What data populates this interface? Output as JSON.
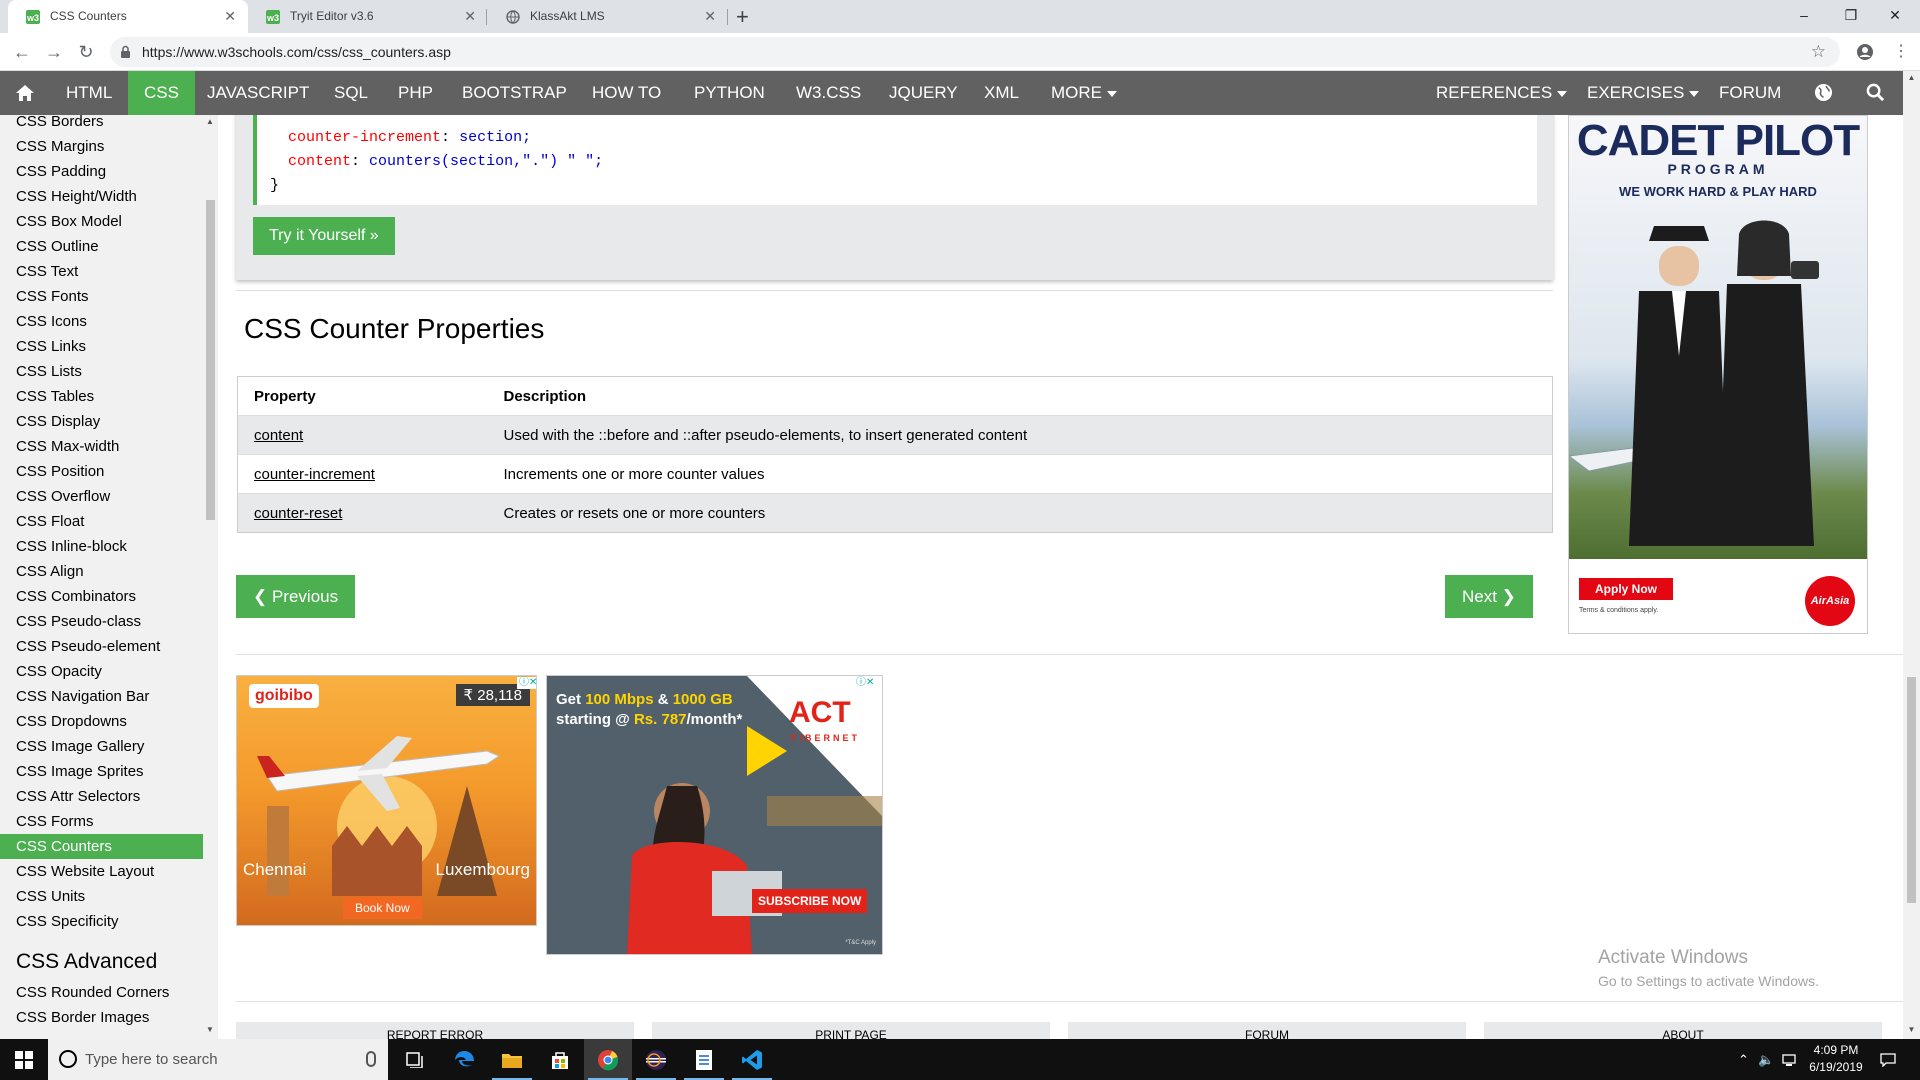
{
  "browser": {
    "tabs": [
      {
        "title": "CSS Counters",
        "active": true
      },
      {
        "title": "Tryit Editor v3.6",
        "active": false
      },
      {
        "title": "KlassAkt LMS",
        "active": false
      }
    ],
    "url": "https://www.w3schools.com/css/css_counters.asp",
    "window_controls": [
      "–",
      "❐",
      "✕"
    ],
    "nav_icons": [
      "back-icon",
      "forward-icon",
      "reload-icon"
    ]
  },
  "topnav": {
    "home_icon": "home-icon",
    "items": [
      "HTML",
      "CSS",
      "JAVASCRIPT",
      "SQL",
      "PHP",
      "BOOTSTRAP",
      "HOW TO",
      "PYTHON",
      "W3.CSS",
      "JQUERY",
      "XML",
      "MORE"
    ],
    "active": "CSS",
    "right_items": [
      "REFERENCES",
      "EXERCISES",
      "FORUM"
    ],
    "right_icons": [
      "globe-icon",
      "search-icon"
    ]
  },
  "sidebar": {
    "items": [
      "CSS Borders",
      "CSS Margins",
      "CSS Padding",
      "CSS Height/Width",
      "CSS Box Model",
      "CSS Outline",
      "CSS Text",
      "CSS Fonts",
      "CSS Icons",
      "CSS Links",
      "CSS Lists",
      "CSS Tables",
      "CSS Display",
      "CSS Max-width",
      "CSS Position",
      "CSS Overflow",
      "CSS Float",
      "CSS Inline-block",
      "CSS Align",
      "CSS Combinators",
      "CSS Pseudo-class",
      "CSS Pseudo-element",
      "CSS Opacity",
      "CSS Navigation Bar",
      "CSS Dropdowns",
      "CSS Image Gallery",
      "CSS Image Sprites",
      "CSS Attr Selectors",
      "CSS Forms",
      "CSS Counters",
      "CSS Website Layout",
      "CSS Units",
      "CSS Specificity"
    ],
    "active": "CSS Counters",
    "advanced_heading": "CSS Advanced",
    "advanced_items": [
      "CSS Rounded Corners",
      "CSS Border Images"
    ]
  },
  "example": {
    "code_lines": [
      {
        "prop": "counter-increment",
        "value": "section;"
      },
      {
        "prop": "content",
        "value": "counters(section,\".\") \" \";"
      }
    ],
    "closing_brace": "}",
    "try_button": "Try it Yourself »"
  },
  "section": {
    "title": "CSS Counter Properties",
    "table_headers": [
      "Property",
      "Description"
    ],
    "rows": [
      {
        "property": "content",
        "description": "Used with the ::before and ::after pseudo-elements, to insert generated content"
      },
      {
        "property": "counter-increment",
        "description": "Increments one or more counter values"
      },
      {
        "property": "counter-reset",
        "description": "Creates or resets one or more counters"
      }
    ]
  },
  "pager": {
    "previous": "❮ Previous",
    "next": "Next ❯"
  },
  "ads": {
    "right": {
      "title": "CADET PILOT",
      "subtitle": "PROGRAM",
      "tagline": "WE WORK HARD & PLAY HARD",
      "apply": "Apply Now",
      "terms": "Terms & conditions apply.",
      "brand": "AirAsia"
    },
    "goibibo": {
      "logo": "goibibo",
      "price": "₹ 28,118",
      "from": "Chennai",
      "to": "Luxembourg",
      "cta": "Book Now"
    },
    "act": {
      "line1_a": "Get ",
      "line1_b": "100 Mbps",
      "line1_c": " & ",
      "line1_d": "1000 GB",
      "line2_a": "starting @ ",
      "line2_b": "Rs. 787",
      "line2_c": "/month*",
      "logo": "ACT",
      "logo_sub": "FIBERNET",
      "cta": "SUBSCRIBE NOW",
      "tc": "*T&C Apply"
    }
  },
  "footer": [
    "REPORT ERROR",
    "PRINT PAGE",
    "FORUM",
    "ABOUT"
  ],
  "watermark": {
    "line1": "Activate Windows",
    "line2": "Go to Settings to activate Windows."
  },
  "taskbar": {
    "search_placeholder": "Type here to search",
    "time": "4:09 PM",
    "date": "6/19/2019"
  },
  "colors": {
    "accent": "#4caf50",
    "nav_bg": "#616161",
    "sidebar_bg": "#f1f1f1",
    "code_prop": "#ff0000",
    "code_value": "#0000cd"
  }
}
